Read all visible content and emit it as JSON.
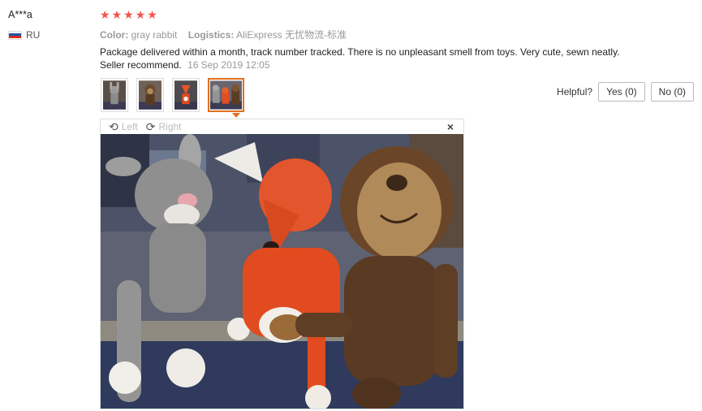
{
  "review": {
    "user": "A***a",
    "country_code": "RU",
    "rating": 5,
    "color_label": "Color:",
    "color_value": "gray rabbit",
    "logistics_label": "Logistics:",
    "logistics_value": "AliExpress 无忧物流-标准",
    "text": "Package delivered within a month, track number tracked. There is no unpleasant smell from toys. Very cute, sewn neatly. Seller recommend.",
    "date": "16 Sep 2019 12:05",
    "thumbnails": [
      "rabbit-photo",
      "monkey-photo",
      "fox-photo",
      "group-photo"
    ],
    "selected_thumbnail": 3
  },
  "helpful": {
    "label": "Helpful?",
    "yes_label": "Yes (0)",
    "no_label": "No (0)"
  },
  "viewer": {
    "left_label": "Left",
    "right_label": "Right",
    "close_label": "×"
  },
  "colors": {
    "star": "#f5524b",
    "active_thumb": "#e0701f",
    "flag_white": "#ffffff",
    "flag_blue": "#1c57a5",
    "flag_red": "#d52b1e"
  }
}
